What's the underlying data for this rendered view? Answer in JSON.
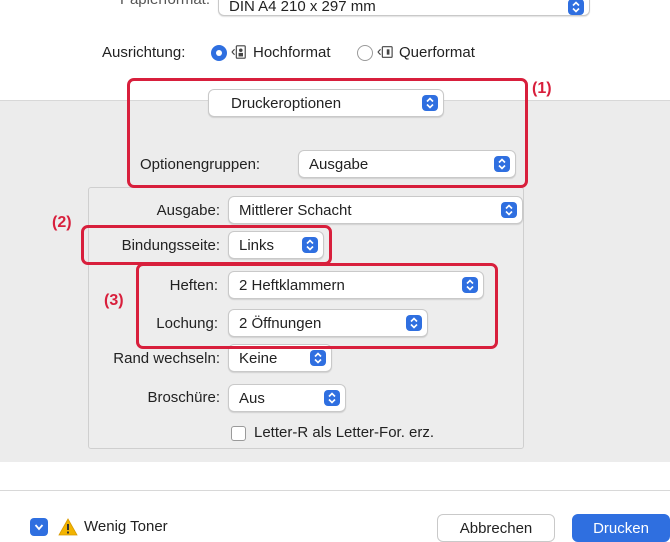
{
  "top": {
    "paper_format": {
      "label": "Papierformat:",
      "value": "DIN A4 210 x 297 mm"
    },
    "orientation": {
      "label": "Ausrichtung:",
      "portrait": "Hochformat",
      "landscape": "Querformat"
    }
  },
  "section_popup": {
    "value": "Druckeroptionen"
  },
  "option_groups": {
    "label": "Optionengruppen:",
    "value": "Ausgabe"
  },
  "settings": {
    "output": {
      "label": "Ausgabe:",
      "value": "Mittlerer Schacht"
    },
    "binding": {
      "label": "Bindungsseite:",
      "value": "Links"
    },
    "stapling": {
      "label": "Heften:",
      "value": "2 Heftklammern"
    },
    "punching": {
      "label": "Lochung:",
      "value": "2 Öffnungen"
    },
    "margin_shift": {
      "label": "Rand wechseln:",
      "value": "Keine"
    },
    "booklet": {
      "label": "Broschüre:",
      "value": "Aus"
    },
    "letter_checkbox": {
      "label": "Letter-R als Letter-For. erz.",
      "checked": false
    }
  },
  "annotations": {
    "one": "(1)",
    "two": "(2)",
    "three": "(3)"
  },
  "footer": {
    "warning": "Wenig Toner",
    "cancel": "Abbrechen",
    "print": "Drucken"
  },
  "colors": {
    "accent": "#2f6fe0",
    "highlight": "#d81f3c",
    "warning": "#f2b400"
  }
}
